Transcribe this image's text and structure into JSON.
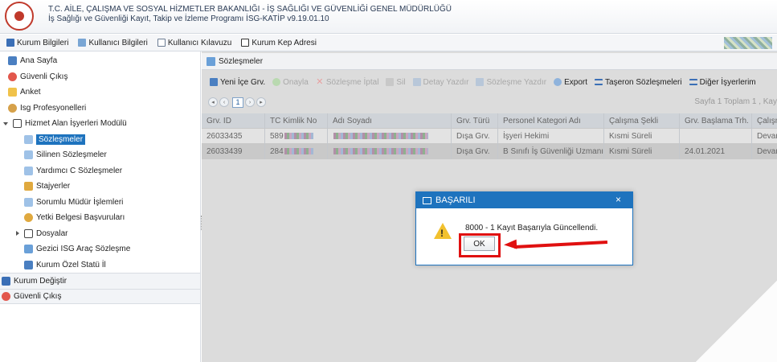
{
  "header": {
    "title_line1": "T.C. AİLE, ÇALIŞMA VE SOSYAL HİZMETLER BAKANLIĞI - İŞ SAĞLIĞI VE GÜVENLİĞİ GENEL MÜDÜRLÜĞÜ",
    "title_line2": "İş Sağlığı ve Güvenliği Kayıt, Takip ve İzleme Programı İSG-KATİP v9.19.01.10"
  },
  "topnav": [
    {
      "label": "Kurum Bilgileri",
      "icon": "building-icon"
    },
    {
      "label": "Kullanıcı Bilgileri",
      "icon": "user-card-icon"
    },
    {
      "label": "Kullanıcı Kılavuzu",
      "icon": "document-icon"
    },
    {
      "label": "Kurum Kep Adresi",
      "icon": "email-icon"
    }
  ],
  "sidebar": {
    "items": [
      {
        "label": "Ana Sayfa",
        "icon": "home-icon"
      },
      {
        "label": "Güvenli Çıkış",
        "icon": "logout-icon"
      },
      {
        "label": "Anket",
        "icon": "survey-icon"
      },
      {
        "label": "Isg Profesyonelleri",
        "icon": "person-icon"
      },
      {
        "label": "Hizmet Alan İşyerleri Modülü",
        "icon": "folder-icon"
      },
      {
        "label": "Sözleşmeler",
        "icon": "document-icon"
      },
      {
        "label": "Silinen Sözleşmeler",
        "icon": "document-icon"
      },
      {
        "label": "Yardımcı C Sözleşmeler",
        "icon": "document-icon"
      },
      {
        "label": "Stajyerler",
        "icon": "student-icon"
      },
      {
        "label": "Sorumlu Müdür İşlemleri",
        "icon": "document-icon"
      },
      {
        "label": "Yetki Belgesi Başvuruları",
        "icon": "user-group-icon"
      },
      {
        "label": "Dosyalar",
        "icon": "folder-icon"
      },
      {
        "label": "Gezici ISG Araç Sözleşme",
        "icon": "vehicle-icon"
      },
      {
        "label": "Kurum Özel Statü İl",
        "icon": "building-icon"
      }
    ],
    "groups": [
      {
        "label": "Kurum Değiştir",
        "icon": "building-icon"
      },
      {
        "label": "Güvenli Çıkış",
        "icon": "logout-icon"
      }
    ]
  },
  "panel": {
    "title": "Sözleşmeler"
  },
  "toolbar": [
    {
      "label": "Yeni İçe Grv.",
      "enabled": true,
      "icon": "add-icon"
    },
    {
      "label": "Onayla",
      "enabled": false,
      "icon": "check-icon"
    },
    {
      "label": "Sözleşme İptal",
      "enabled": false,
      "icon": "cancel-icon"
    },
    {
      "label": "Sil",
      "enabled": false,
      "icon": "delete-icon"
    },
    {
      "label": "Detay Yazdır",
      "enabled": false,
      "icon": "print-icon"
    },
    {
      "label": "Sözleşme Yazdır",
      "enabled": false,
      "icon": "print-icon"
    },
    {
      "label": "Export",
      "enabled": true,
      "icon": "export-icon"
    },
    {
      "label": "Taşeron Sözleşmeleri",
      "enabled": true,
      "icon": "list-icon"
    },
    {
      "label": "Diğer İşyerlerim",
      "enabled": true,
      "icon": "list-icon"
    }
  ],
  "pager": {
    "current_page": "1",
    "info": "Sayfa 1 Toplam 1 , Kay"
  },
  "grid": {
    "columns": [
      "Grv. ID",
      "TC Kimlik No",
      "Adı Soyadı",
      "Grv. Türü",
      "Personel Kategori Adı",
      "Çalışma Şekli",
      "Grv. Başlama Trh.",
      "Çalışm"
    ],
    "rows": [
      [
        "26033435",
        "589",
        "",
        "Dışa Grv.",
        "İşyeri Hekimi",
        "Kısmi Süreli",
        "",
        "Devan"
      ],
      [
        "26033439",
        "284",
        "",
        "Dışa Grv.",
        "B Sınıfı İş Güvenliği Uzmanı",
        "Kısmi Süreli",
        "24.01.2021",
        "Devan"
      ]
    ]
  },
  "dialog": {
    "title": "BAŞARILI",
    "close": "×",
    "message": "8000 - 1 Kayıt Başarıyla Güncellendi.",
    "ok_label": "OK"
  },
  "colors": {
    "primary": "#1e73be",
    "highlight": "#e01010",
    "warning": "#f2c12e"
  }
}
